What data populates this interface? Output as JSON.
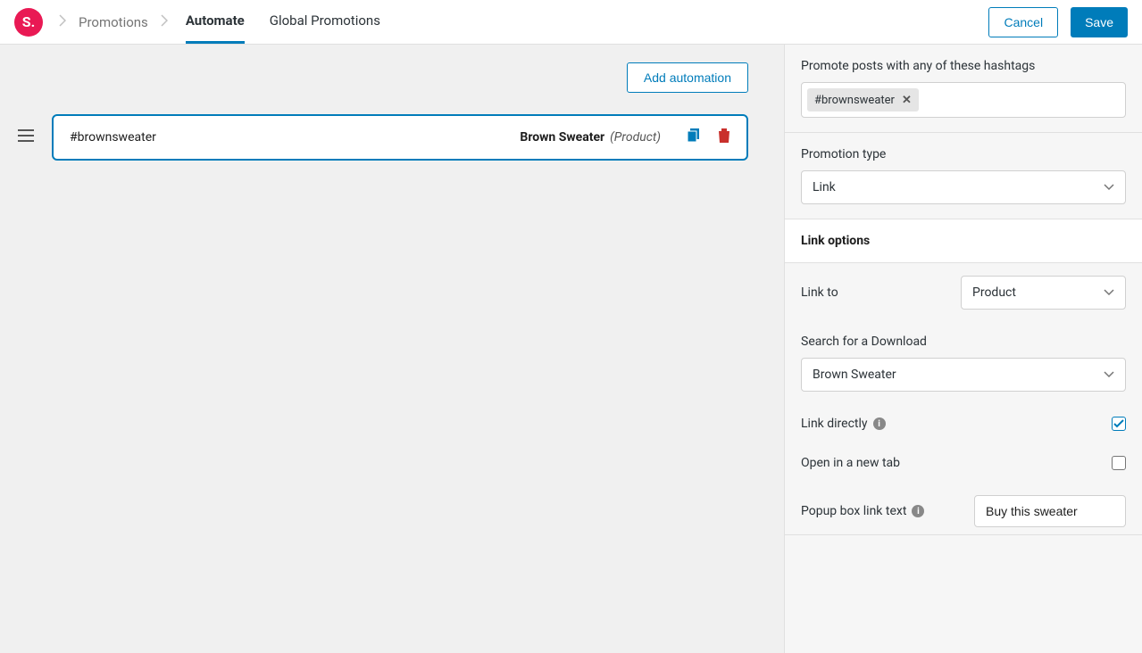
{
  "logo_text": "S.",
  "breadcrumb": {
    "root": "Promotions"
  },
  "tabs": {
    "automate": "Automate",
    "global": "Global Promotions"
  },
  "header_buttons": {
    "cancel": "Cancel",
    "save": "Save"
  },
  "left": {
    "add_button": "Add automation",
    "rows": [
      {
        "tag": "#brownsweater",
        "product_name": "Brown Sweater",
        "product_type": "(Product)"
      }
    ]
  },
  "right": {
    "hashtag_label": "Promote posts with any of these hashtags",
    "hashtag_value": "#brownsweater",
    "promotion_type_label": "Promotion type",
    "promotion_type_value": "Link",
    "link_options_title": "Link options",
    "link_to_label": "Link to",
    "link_to_value": "Product",
    "download_label": "Search for a Download",
    "download_value": "Brown Sweater",
    "link_directly_label": "Link directly",
    "link_directly_checked": true,
    "open_new_tab_label": "Open in a new tab",
    "open_new_tab_checked": false,
    "popup_label": "Popup box link text",
    "popup_value": "Buy this sweater"
  }
}
